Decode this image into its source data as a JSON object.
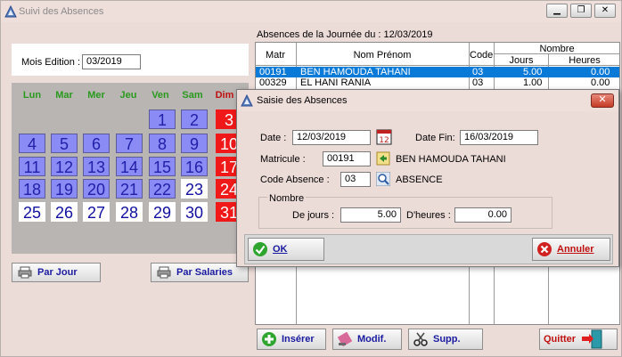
{
  "window": {
    "title": "Suivi des Absences",
    "controls": [
      "minimize-icon",
      "restore-icon",
      "close-icon"
    ]
  },
  "mois": {
    "label": "Mois Edition :",
    "value": "03/2019"
  },
  "calendar": {
    "days": [
      "Lun",
      "Mar",
      "Mer",
      "Jeu",
      "Ven",
      "Sam",
      "Dim"
    ],
    "weeks": [
      [
        "",
        "",
        "",
        "",
        "1",
        "2",
        "3"
      ],
      [
        "4",
        "5",
        "6",
        "7",
        "8",
        "9",
        "10"
      ],
      [
        "11",
        "12",
        "13",
        "14",
        "15",
        "16",
        "17"
      ],
      [
        "18",
        "19",
        "20",
        "21",
        "22",
        "23",
        "24"
      ],
      [
        "25",
        "26",
        "27",
        "28",
        "29",
        "30",
        "31"
      ]
    ]
  },
  "buttons": {
    "par_jour": "Par Jour",
    "par_salaries": "Par Salaries",
    "inserer": "Insérer",
    "modifier": "Modif.",
    "supprimer": "Supp.",
    "quitter": "Quitter"
  },
  "absences": {
    "title": "Absences de la Journée du :  12/03/2019",
    "headers": {
      "matr": "Matr",
      "nom": "Nom Prénom",
      "code": "Code",
      "nombre": "Nombre",
      "jours": "Jours",
      "heures": "Heures"
    },
    "rows": [
      {
        "matr": "00191",
        "nom": "BEN HAMOUDA TAHANI",
        "code": "03",
        "jours": "5.00",
        "heures": "0.00"
      },
      {
        "matr": "00329",
        "nom": "EL HANI RANIA",
        "code": "03",
        "jours": "1.00",
        "heures": "0.00"
      }
    ]
  },
  "dialog": {
    "title": "Saisie des Absences",
    "date_label": "Date :",
    "date_value": "12/03/2019",
    "date_fin_label": "Date Fin:",
    "date_fin_value": "16/03/2019",
    "matricule_label": "Matricule :",
    "matricule_value": "00191",
    "employee_name": "BEN HAMOUDA TAHANI",
    "code_label": "Code Absence :",
    "code_value": "03",
    "code_name": "ABSENCE",
    "nombre_label": "Nombre",
    "jours_label": "De jours :",
    "jours_value": "5.00",
    "heures_label": "D'heures :",
    "heures_value": "0.00",
    "ok_label": "OK",
    "annuler_label": "Annuler"
  }
}
